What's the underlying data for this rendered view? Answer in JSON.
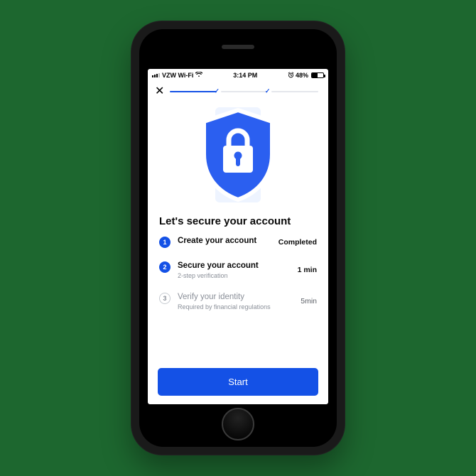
{
  "status_bar": {
    "carrier": "VZW Wi-Fi",
    "wifi_icon": "wifi",
    "time": "3:14 PM",
    "alarm_icon": "alarm",
    "battery_pct": "48%"
  },
  "nav": {
    "close_icon": "✕",
    "progress": [
      {
        "active": true,
        "check": "✓"
      },
      {
        "active": false,
        "check": "✓"
      },
      {
        "active": false,
        "check": ""
      }
    ]
  },
  "hero": {
    "icon": "shield-lock",
    "accent_color": "#2b5ff0"
  },
  "heading": "Let's secure your account",
  "steps": [
    {
      "num": "1",
      "title": "Create your account",
      "subtitle": "",
      "meta": "Completed",
      "state": "done"
    },
    {
      "num": "2",
      "title": "Secure your account",
      "subtitle": "2-step verification",
      "meta": "1 min",
      "state": "current"
    },
    {
      "num": "3",
      "title": "Verify your identity",
      "subtitle": "Required by financial regulations",
      "meta": "5min",
      "state": "upcoming"
    }
  ],
  "action": {
    "label": "Start"
  }
}
